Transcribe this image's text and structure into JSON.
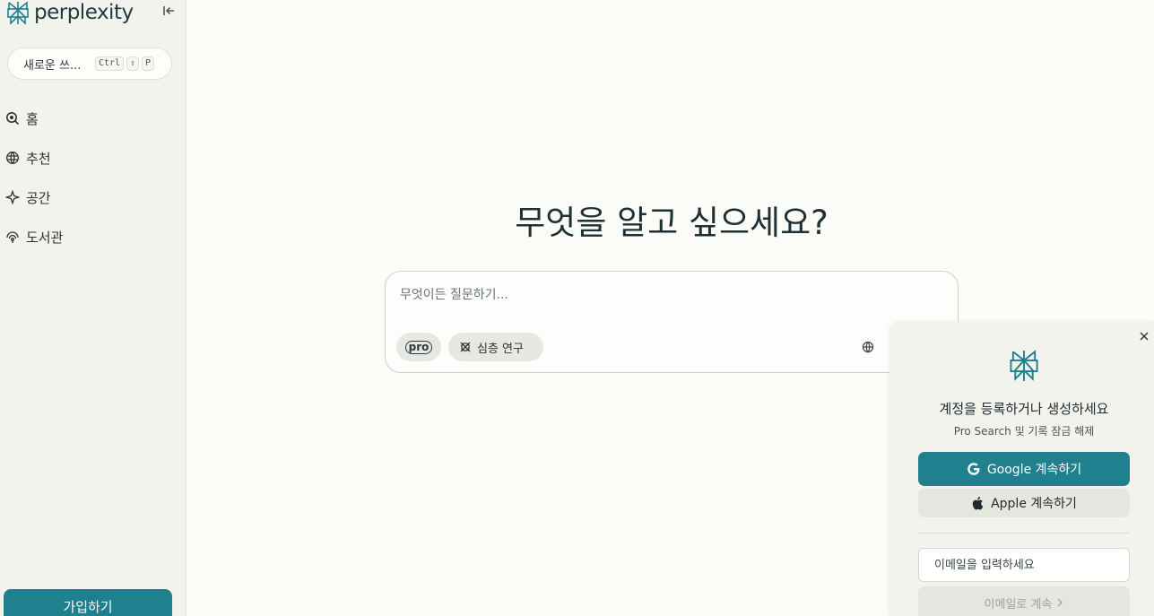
{
  "sidebar": {
    "brand": "perplexity",
    "new_thread": {
      "label": "새로운 쓰...",
      "shortcut": [
        "Ctrl",
        "⇧",
        "P"
      ]
    },
    "items": [
      {
        "label": "홈",
        "icon": "search-icon"
      },
      {
        "label": "추천",
        "icon": "globe-icon"
      },
      {
        "label": "공간",
        "icon": "sparkle-icon"
      },
      {
        "label": "도서관",
        "icon": "library-icon"
      }
    ],
    "signup_label": "가입하기"
  },
  "main": {
    "headline": "무엇을 알고 싶으세요?",
    "search": {
      "placeholder": "무엇이든 질문하기...",
      "pro_label": "pro",
      "deep_research_label": "심층 연구"
    }
  },
  "login_panel": {
    "title": "계정을 등록하거나 생성하세요",
    "subtitle": "Pro Search 및 기록 잠금 해제",
    "google_label": "Google 계속하기",
    "apple_label": "Apple 계속하기",
    "email_placeholder": "이메일을 입력하세요",
    "email_button_label": "이메일로 계속"
  },
  "colors": {
    "accent": "#20808d",
    "sidebar_bg": "#f3f3ee",
    "main_bg": "#fbfbf7"
  }
}
